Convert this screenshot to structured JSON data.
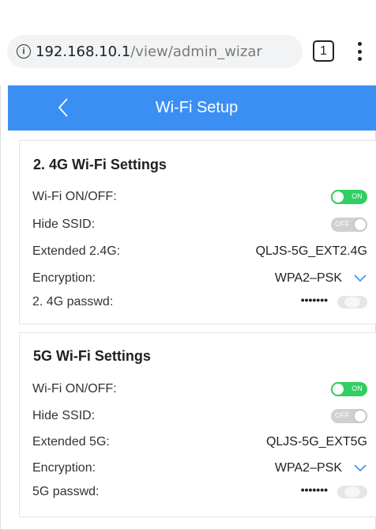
{
  "browser": {
    "url_host": "192.168.10.1",
    "url_path": "/view/admin_wizar",
    "tab_count": "1"
  },
  "header": {
    "title": "Wi-Fi Setup"
  },
  "wifi_24": {
    "title": "2. 4G Wi-Fi Settings",
    "wifi_onoff_label": "Wi-Fi ON/OFF:",
    "wifi_onoff_state": "ON",
    "hide_ssid_label": "Hide SSID:",
    "hide_ssid_state": "OFF",
    "extended_label": "Extended 2.4G:",
    "extended_value": "QLJS-5G_EXT2.4G",
    "encryption_label": "Encryption:",
    "encryption_value": "WPA2–PSK",
    "passwd_label": "2. 4G passwd:",
    "passwd_value": "•••••••"
  },
  "wifi_5": {
    "title": "5G Wi-Fi Settings",
    "wifi_onoff_label": "Wi-Fi ON/OFF:",
    "wifi_onoff_state": "ON",
    "hide_ssid_label": "Hide SSID:",
    "hide_ssid_state": "OFF",
    "extended_label": "Extended 5G:",
    "extended_value": "QLJS-5G_EXT5G",
    "encryption_label": "Encryption:",
    "encryption_value": "WPA2–PSK",
    "passwd_label": "5G passwd:",
    "passwd_value": "•••••••"
  },
  "colors": {
    "header_blue": "#3b8ff3",
    "toggle_on": "#2fcf62",
    "toggle_off": "#d0d0d0",
    "chevron": "#3b8ff3"
  },
  "icons": {
    "info": "info-icon",
    "back": "chevron-left-icon",
    "menu": "more-vert-icon",
    "dropdown": "chevron-down-icon",
    "password_visibility": "eye-toggle-icon"
  }
}
